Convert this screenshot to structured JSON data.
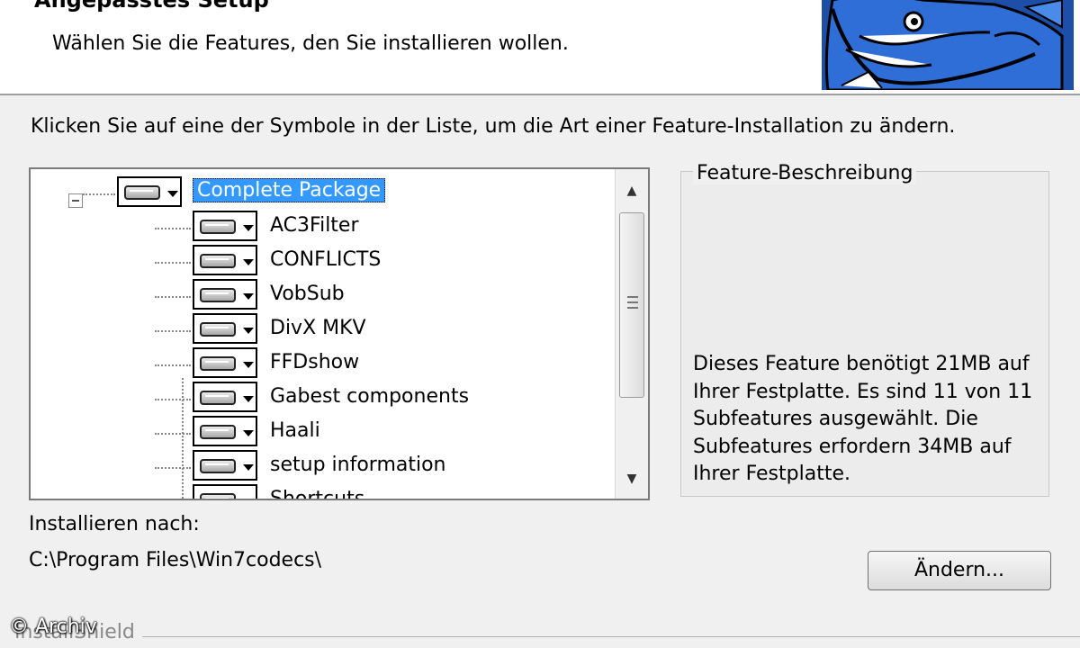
{
  "header": {
    "title": "Angepasstes Setup",
    "subtitle": "Wählen Sie die Features, den Sie installieren wollen."
  },
  "instruction": "Klicken Sie auf eine der Symbole in der Liste, um die Art einer Feature-Installation zu ändern.",
  "tree": {
    "root": "Complete Package",
    "items": [
      "AC3Filter",
      "CONFLICTS",
      "VobSub",
      "DivX MKV",
      "FFDshow",
      "Gabest components",
      "Haali",
      "setup information",
      "Shortcuts"
    ]
  },
  "description": {
    "title": "Feature-Beschreibung",
    "text": "Dieses Feature benötigt 21MB auf Ihrer Festplatte. Es sind 11 von 11 Subfeatures ausgewählt. Die Subfeatures erfordern 34MB auf Ihrer Festplatte."
  },
  "install": {
    "label": "Installieren nach:",
    "path": "C:\\Program Files\\Win7codecs\\",
    "change_button": "Ändern..."
  },
  "footer": {
    "brand": "InstallShield",
    "watermark": "© Archiv"
  }
}
